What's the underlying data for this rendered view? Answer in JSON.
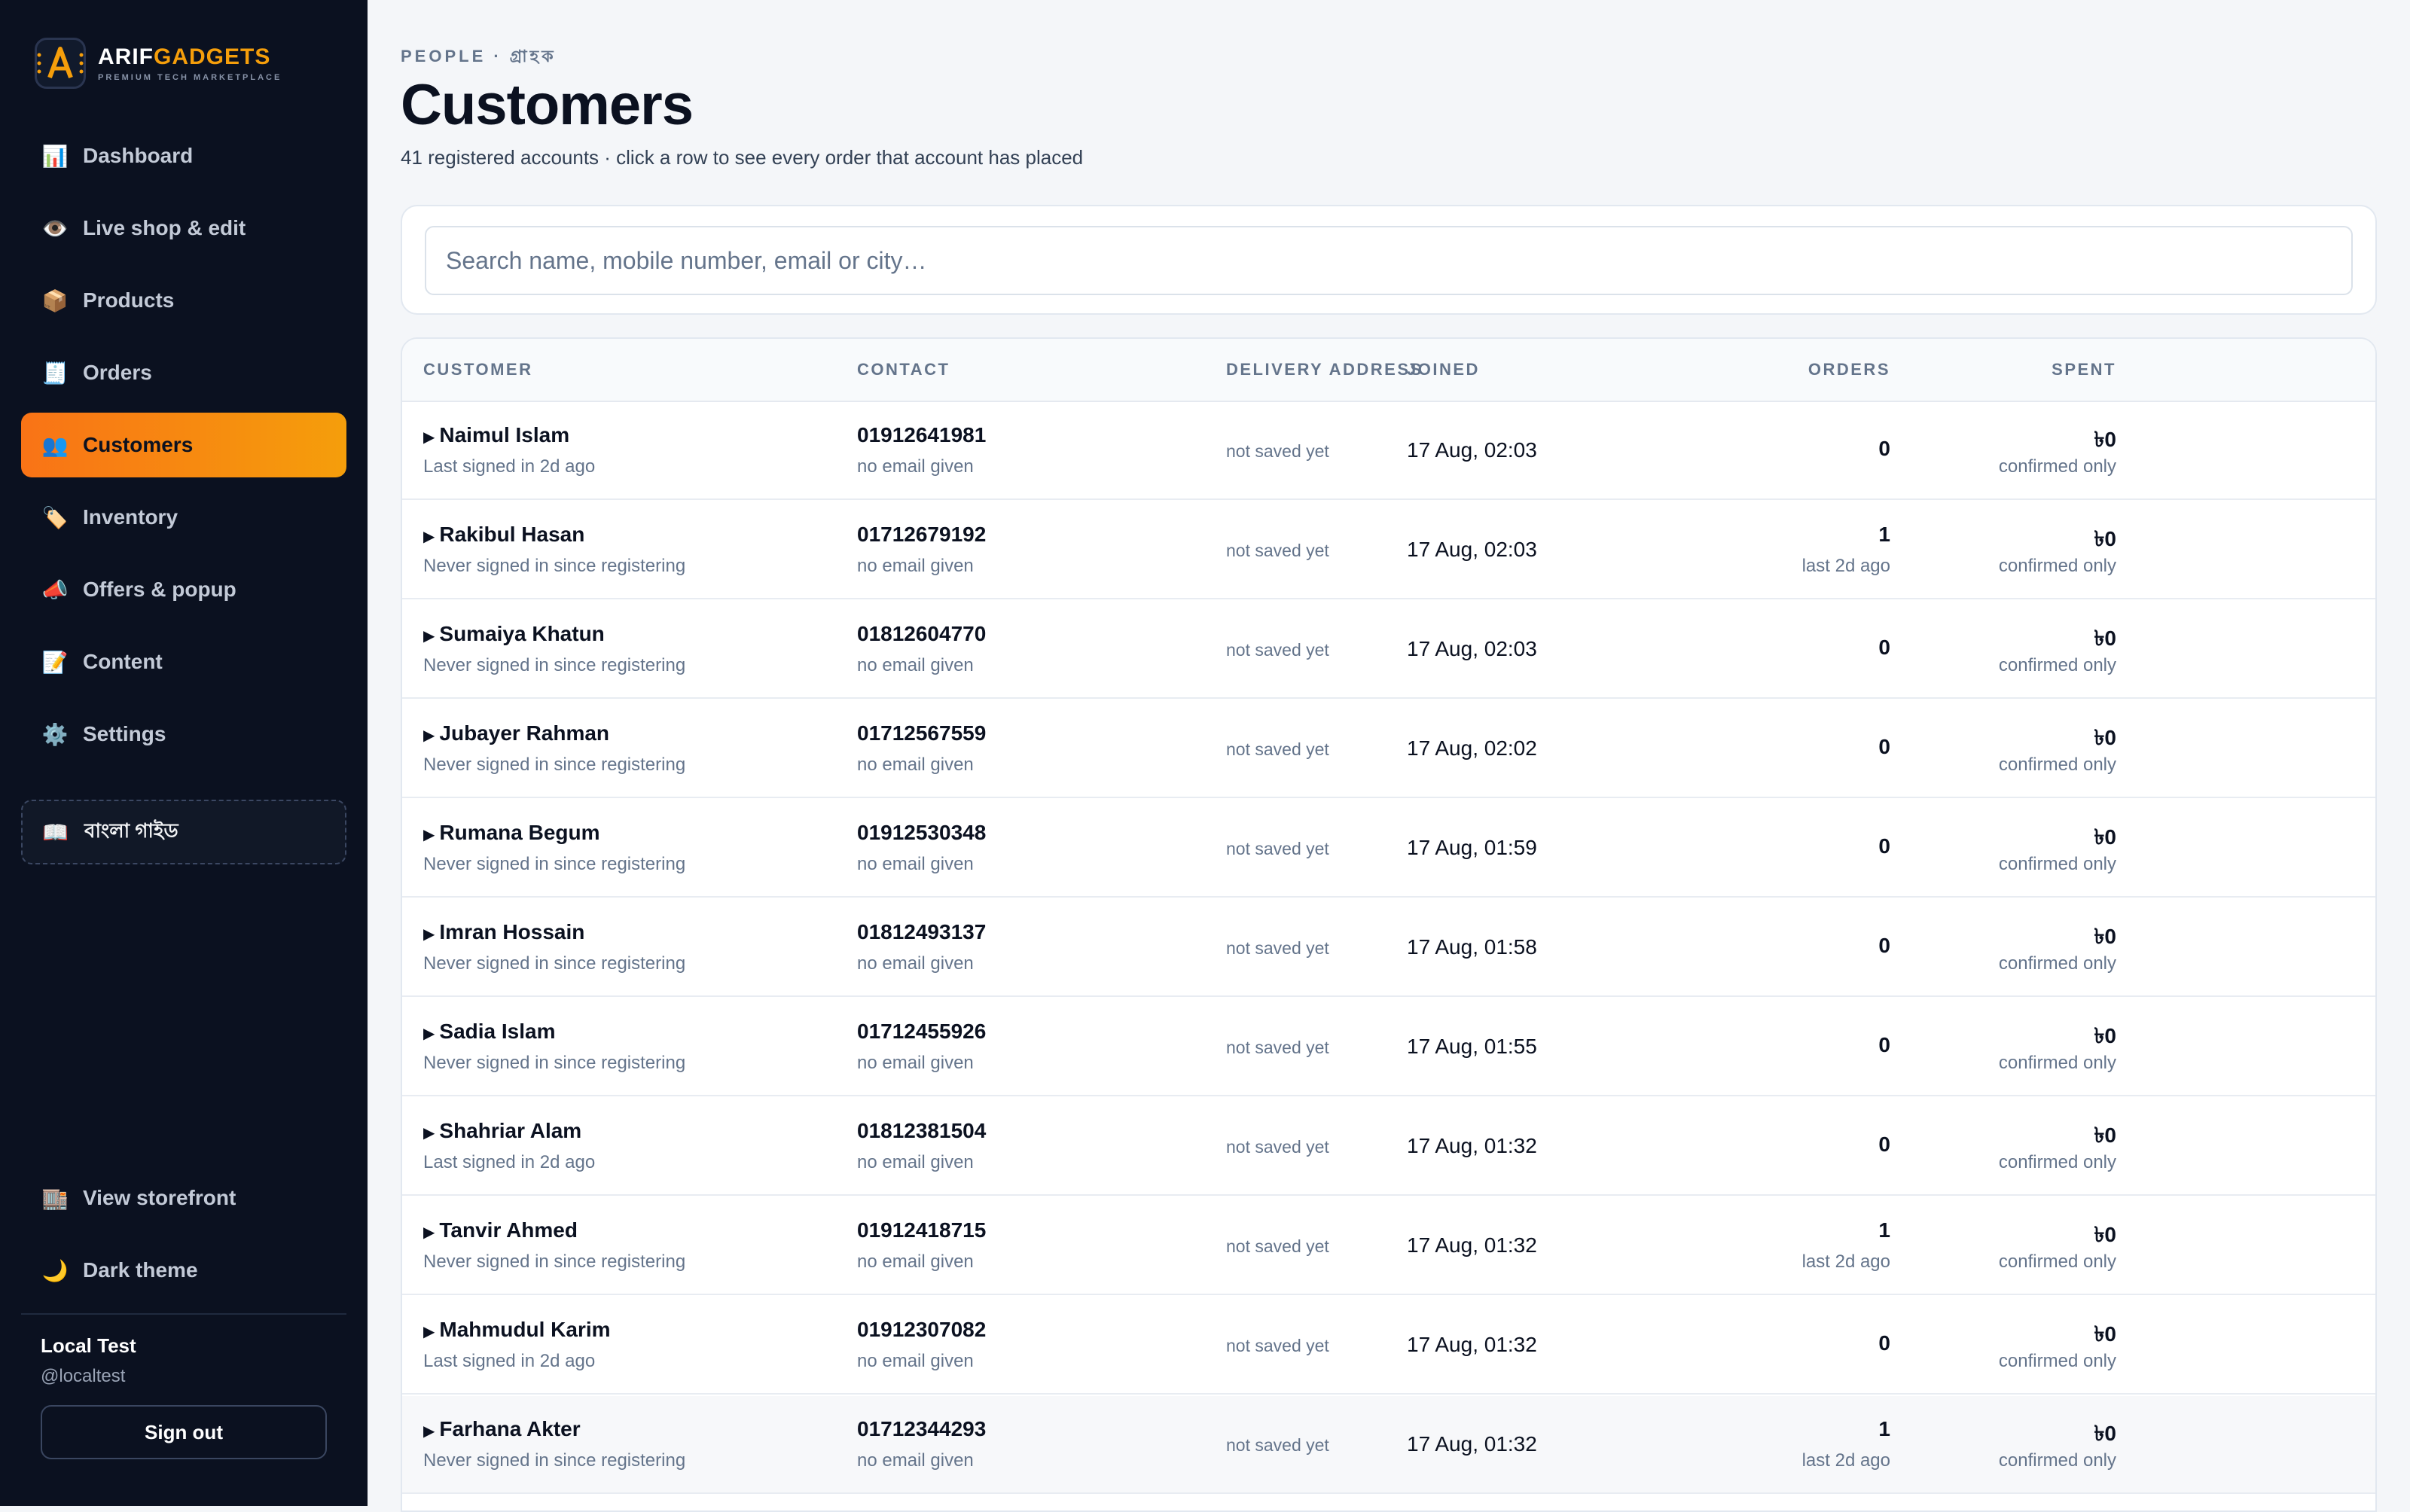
{
  "brand": {
    "name_a": "ARIF",
    "name_b": "GADGETS",
    "tagline": "PREMIUM TECH MARKETPLACE"
  },
  "sidebar": {
    "items": [
      {
        "label": "Dashboard",
        "icon": "📊"
      },
      {
        "label": "Live shop & edit",
        "icon": "👁️"
      },
      {
        "label": "Products",
        "icon": "📦"
      },
      {
        "label": "Orders",
        "icon": "🧾"
      },
      {
        "label": "Customers",
        "icon": "👥",
        "active": true
      },
      {
        "label": "Inventory",
        "icon": "🏷️"
      },
      {
        "label": "Offers & popup",
        "icon": "📣"
      },
      {
        "label": "Content",
        "icon": "📝"
      },
      {
        "label": "Settings",
        "icon": "⚙️"
      }
    ],
    "guide": {
      "label": "বাংলা গাইড",
      "icon": "📖"
    },
    "storefront": {
      "label": "View storefront",
      "icon": "🏬"
    },
    "theme": {
      "label": "Dark theme",
      "icon": "🌙"
    },
    "user": {
      "name": "Local Test",
      "handle": "@localtest"
    },
    "signout_label": "Sign out",
    "accent_gradient": [
      "#f97316",
      "#f59e0b"
    ]
  },
  "header": {
    "kicker": "PEOPLE · গ্রাহক",
    "title": "Customers",
    "subtitle": "41 registered accounts · click a row to see every order that account has placed"
  },
  "search": {
    "placeholder": "Search name, mobile number, email or city…"
  },
  "table": {
    "columns": {
      "customer": "CUSTOMER",
      "contact": "CONTACT",
      "address": "DELIVERY ADDRESS",
      "orders": "ORDERS",
      "spent": "SPENT",
      "joined": "JOINED"
    },
    "rows": [
      {
        "name": "Naimul Islam",
        "signed": "Last signed in 2d ago",
        "phone": "01912641981",
        "email": "no email given",
        "address": "not saved yet",
        "orders": "0",
        "last": "",
        "spent": "৳0",
        "spent_note": "confirmed only",
        "joined": "17 Aug, 02:03"
      },
      {
        "name": "Rakibul Hasan",
        "signed": "Never signed in since registering",
        "phone": "01712679192",
        "email": "no email given",
        "address": "not saved yet",
        "orders": "1",
        "last": "last 2d ago",
        "spent": "৳0",
        "spent_note": "confirmed only",
        "joined": "17 Aug, 02:03"
      },
      {
        "name": "Sumaiya Khatun",
        "signed": "Never signed in since registering",
        "phone": "01812604770",
        "email": "no email given",
        "address": "not saved yet",
        "orders": "0",
        "last": "",
        "spent": "৳0",
        "spent_note": "confirmed only",
        "joined": "17 Aug, 02:03"
      },
      {
        "name": "Jubayer Rahman",
        "signed": "Never signed in since registering",
        "phone": "01712567559",
        "email": "no email given",
        "address": "not saved yet",
        "orders": "0",
        "last": "",
        "spent": "৳0",
        "spent_note": "confirmed only",
        "joined": "17 Aug, 02:02"
      },
      {
        "name": "Rumana Begum",
        "signed": "Never signed in since registering",
        "phone": "01912530348",
        "email": "no email given",
        "address": "not saved yet",
        "orders": "0",
        "last": "",
        "spent": "৳0",
        "spent_note": "confirmed only",
        "joined": "17 Aug, 01:59"
      },
      {
        "name": "Imran Hossain",
        "signed": "Never signed in since registering",
        "phone": "01812493137",
        "email": "no email given",
        "address": "not saved yet",
        "orders": "0",
        "last": "",
        "spent": "৳0",
        "spent_note": "confirmed only",
        "joined": "17 Aug, 01:58"
      },
      {
        "name": "Sadia Islam",
        "signed": "Never signed in since registering",
        "phone": "01712455926",
        "email": "no email given",
        "address": "not saved yet",
        "orders": "0",
        "last": "",
        "spent": "৳0",
        "spent_note": "confirmed only",
        "joined": "17 Aug, 01:55"
      },
      {
        "name": "Shahriar Alam",
        "signed": "Last signed in 2d ago",
        "phone": "01812381504",
        "email": "no email given",
        "address": "not saved yet",
        "orders": "0",
        "last": "",
        "spent": "৳0",
        "spent_note": "confirmed only",
        "joined": "17 Aug, 01:32"
      },
      {
        "name": "Tanvir Ahmed",
        "signed": "Never signed in since registering",
        "phone": "01912418715",
        "email": "no email given",
        "address": "not saved yet",
        "orders": "1",
        "last": "last 2d ago",
        "spent": "৳0",
        "spent_note": "confirmed only",
        "joined": "17 Aug, 01:32"
      },
      {
        "name": "Mahmudul Karim",
        "signed": "Last signed in 2d ago",
        "phone": "01912307082",
        "email": "no email given",
        "address": "not saved yet",
        "orders": "0",
        "last": "",
        "spent": "৳0",
        "spent_note": "confirmed only",
        "joined": "17 Aug, 01:32"
      },
      {
        "name": "Farhana Akter",
        "signed": "Never signed in since registering",
        "phone": "01712344293",
        "email": "no email given",
        "address": "not saved yet",
        "orders": "1",
        "last": "last 2d ago",
        "spent": "৳0",
        "spent_note": "confirmed only",
        "joined": "17 Aug, 01:32",
        "hover": true
      }
    ]
  }
}
